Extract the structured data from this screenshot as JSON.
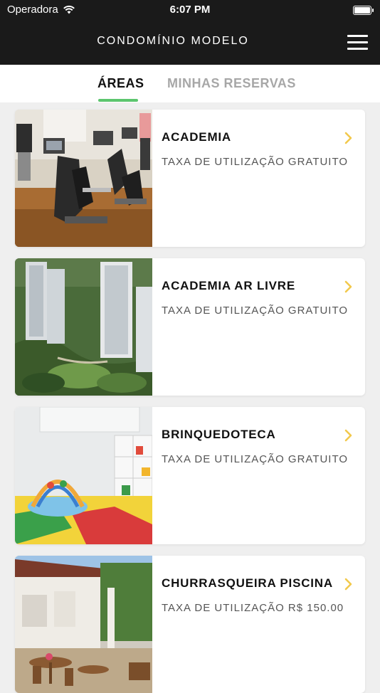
{
  "status_bar": {
    "carrier": "Operadora",
    "time": "6:07 PM"
  },
  "header": {
    "title": "CONDOMÍNIO MODELO",
    "menu_icon": "hamburger-menu-icon"
  },
  "tabs": [
    {
      "label": "ÁREAS",
      "active": true
    },
    {
      "label": "MINHAS RESERVAS",
      "active": false
    }
  ],
  "colors": {
    "accent": "#f2c94c",
    "tab_indicator": "#5cc56e",
    "header_bg": "#1a1a1a"
  },
  "areas": [
    {
      "name": "ACADEMIA",
      "fee": "TAXA DE UTILIZAÇÃO GRATUITO",
      "image": "gym-photo"
    },
    {
      "name": "ACADEMIA AR LIVRE",
      "fee": "TAXA DE UTILIZAÇÃO GRATUITO",
      "image": "towers-aerial-photo"
    },
    {
      "name": "BRINQUEDOTECA",
      "fee": "TAXA DE UTILIZAÇÃO GRATUITO",
      "image": "playroom-photo"
    },
    {
      "name": "CHURRASQUEIRA PISCINA",
      "fee": "TAXA DE UTILIZAÇÃO R$ 150.00",
      "image": "barbecue-area-photo"
    }
  ]
}
